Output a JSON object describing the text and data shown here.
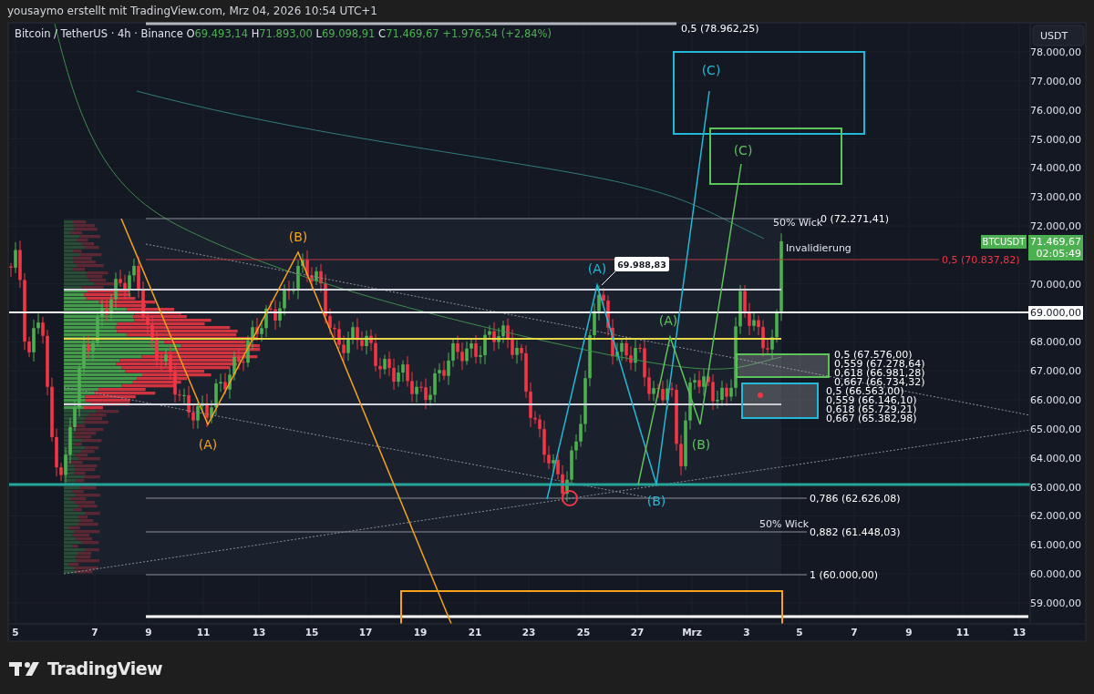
{
  "header": {
    "credit": "yousaymo erstellt mit TradingView.com, Mrz 04, 2026 10:54 UTC+1"
  },
  "legend": {
    "symbol": "Bitcoin / TetherUS · 4h · Binance",
    "ohlc": [
      {
        "label": "O",
        "value": "69.493,14"
      },
      {
        "label": "H",
        "value": "71.893,00"
      },
      {
        "label": "L",
        "value": "69.098,91"
      },
      {
        "label": "C",
        "value": "71.469,67"
      }
    ],
    "change": "+1.976,54 (+2,84%)"
  },
  "currency_button": "USDT",
  "price_axis": {
    "ticks": [
      "78.000,00",
      "77.000,00",
      "76.000,00",
      "75.000,00",
      "74.000,00",
      "73.000,00",
      "72.000,00",
      "70.000,00",
      "68.000,00",
      "67.000,00",
      "66.000,00",
      "65.000,00",
      "64.000,00",
      "63.000,00",
      "62.000,00",
      "61.000,00",
      "60.000,00",
      "59.000,00"
    ],
    "line_label": "69.000,00"
  },
  "last_price": {
    "symbol": "BTCUSDT",
    "price": "71.469,67",
    "countdown": "02:05:49"
  },
  "time_axis": [
    "5",
    "7",
    "9",
    "11",
    "13",
    "15",
    "17",
    "19",
    "21",
    "23",
    "25",
    "27",
    "Mrz",
    "3",
    "5",
    "7",
    "9",
    "11",
    "13"
  ],
  "waves": [
    {
      "text": "(C)",
      "color": "#22b8d6"
    },
    {
      "text": "(C)",
      "color": "#5cc35c"
    },
    {
      "text": "(B)",
      "color": "#f7a21b"
    },
    {
      "text": "(A)",
      "color": "#22b8d6"
    },
    {
      "text": "(A)",
      "color": "#5cc35c"
    },
    {
      "text": "(A)",
      "color": "#f7a21b"
    },
    {
      "text": "(B)",
      "color": "#5cc35c"
    },
    {
      "text": "(B)",
      "color": "#22b8d6"
    }
  ],
  "level_labels": [
    {
      "text": "0,5 (78.962,25)",
      "color": "#ffffff"
    },
    {
      "text": "0 (72.271,41)",
      "color": "#ffffff"
    },
    {
      "text": "0,5 (70.837,82)",
      "color": "#f23645"
    },
    {
      "text": "0,5 (67.576,00)",
      "color": "#ffffff"
    },
    {
      "text": "0,559 (67.278,64)",
      "color": "#ffffff"
    },
    {
      "text": "0,618 (66.981,28)",
      "color": "#ffffff"
    },
    {
      "text": "0,667 (66.734,32)",
      "color": "#ffffff"
    },
    {
      "text": "0,5 (66.563,00)",
      "color": "#ffffff"
    },
    {
      "text": "0,559 (66.146,10)",
      "color": "#ffffff"
    },
    {
      "text": "0,618 (65.729,21)",
      "color": "#ffffff"
    },
    {
      "text": "0,667 (65.382,98)",
      "color": "#ffffff"
    },
    {
      "text": "0,786 (62.626,08)",
      "color": "#ffffff"
    },
    {
      "text": "0,882 (61.448,03)",
      "color": "#ffffff"
    },
    {
      "text": "1 (60.000,00)",
      "color": "#ffffff"
    }
  ],
  "notes": [
    "50% Wick",
    "Invalidierung",
    "50% Wick"
  ],
  "price_callout": "69.988,83",
  "footer": {
    "logo": "TradingView"
  }
}
